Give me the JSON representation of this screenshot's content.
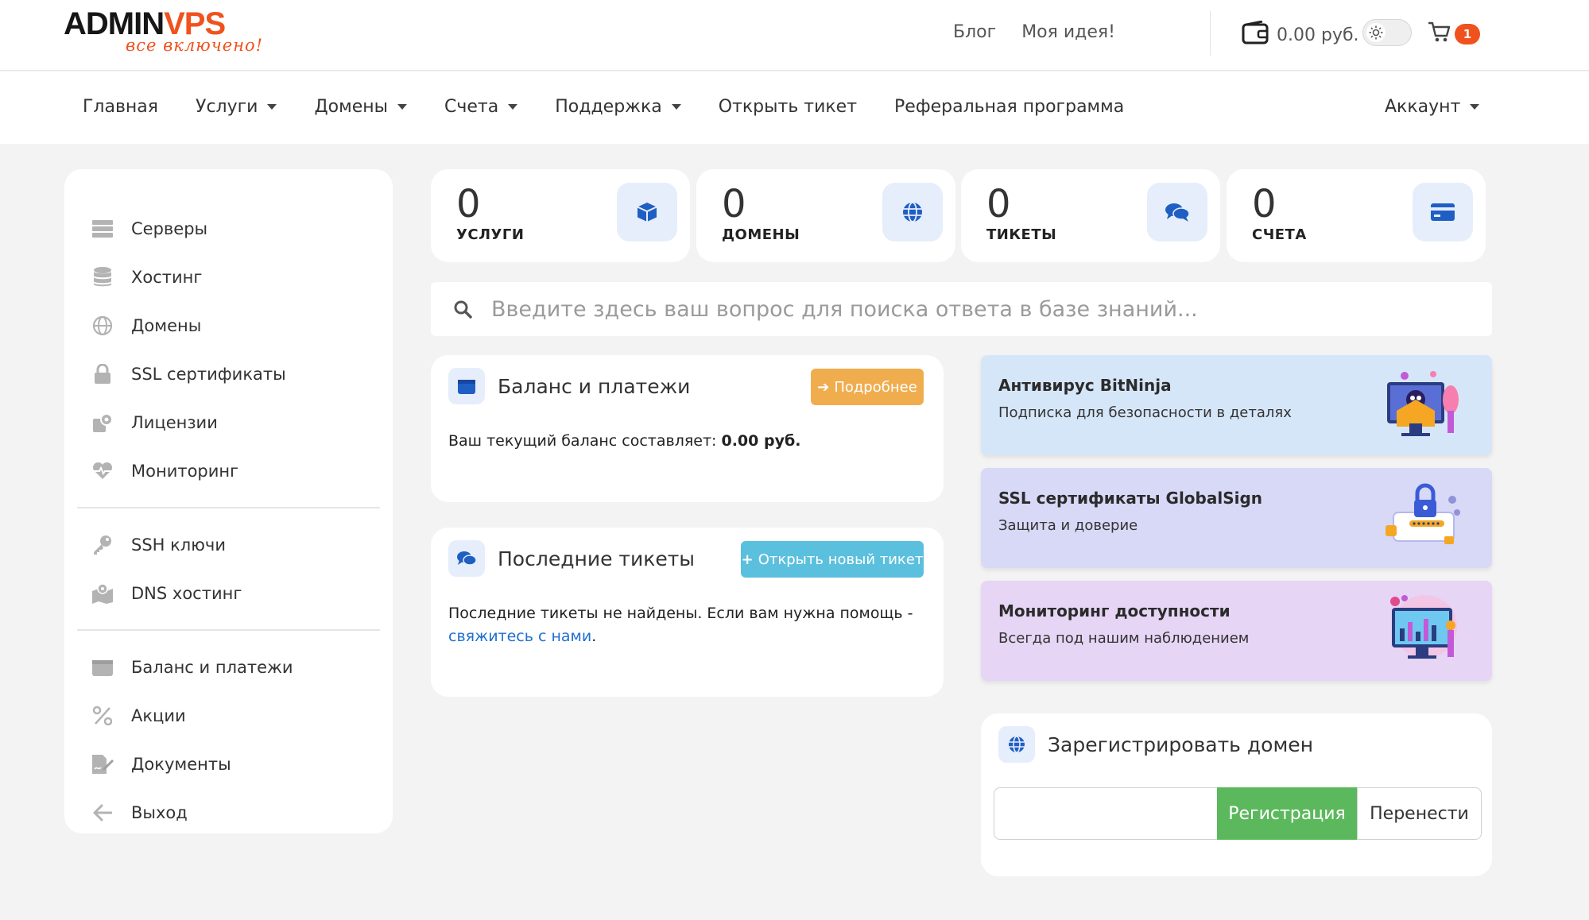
{
  "logo": {
    "main_dark": "ADMIN",
    "main_accent": "VPS",
    "tagline": "все включено!"
  },
  "topbar": {
    "links": [
      "Блог",
      "Моя идея!"
    ],
    "balance": "0.00 руб.",
    "cart_count": "1"
  },
  "nav": {
    "items": [
      "Главная",
      "Услуги",
      "Домены",
      "Счета",
      "Поддержка",
      "Открыть тикет",
      "Реферальная программа"
    ],
    "account": "Аккаунт"
  },
  "sidebar": {
    "group1": [
      "Серверы",
      "Хостинг",
      "Домены",
      "SSL сертификаты",
      "Лицензии",
      "Мониторинг"
    ],
    "group2": [
      "SSH ключи",
      "DNS хостинг"
    ],
    "group3": [
      "Баланс и платежи",
      "Акции",
      "Документы",
      "Выход"
    ]
  },
  "stats": [
    {
      "value": "0",
      "label": "УСЛУГИ",
      "icon": "box-icon"
    },
    {
      "value": "0",
      "label": "ДОМЕНЫ",
      "icon": "globe-icon"
    },
    {
      "value": "0",
      "label": "ТИКЕТЫ",
      "icon": "comments-icon"
    },
    {
      "value": "0",
      "label": "СЧЕТА",
      "icon": "credit-card-icon"
    }
  ],
  "search": {
    "placeholder": "Введите здесь ваш вопрос для поиска ответа в базе знаний..."
  },
  "balance_panel": {
    "title": "Баланс и платежи",
    "button": "Подробнее",
    "text_prefix": "Ваш текущий баланс составляет: ",
    "amount": "0.00 руб."
  },
  "tickets_panel": {
    "title": "Последние тикеты",
    "button": "Открыть новый тикет",
    "text_prefix": "Последние тикеты не найдены. Если вам нужна помощь - ",
    "link": "свяжитесь с нами",
    "text_suffix": "."
  },
  "promos": [
    {
      "title": "Антивирус BitNinja",
      "subtitle": "Подписка для безопасности в деталях",
      "color": "#d6e6f9"
    },
    {
      "title": "SSL сертификаты GlobalSign",
      "subtitle": "Защита и доверие",
      "color": "#d8d9f7"
    },
    {
      "title": "Мониторинг доступности",
      "subtitle": "Всегда под нашим наблюдением",
      "color": "#e6d5f5"
    }
  ],
  "domain_panel": {
    "title": "Зарегистрировать домен",
    "register": "Регистрация",
    "transfer": "Перенести"
  },
  "colors": {
    "accent": "#f0521e",
    "icon_blue": "#1f5fc4",
    "orange_btn": "#f0ad4e",
    "cyan_btn": "#5bc0de",
    "green_btn": "#5cb85c"
  }
}
